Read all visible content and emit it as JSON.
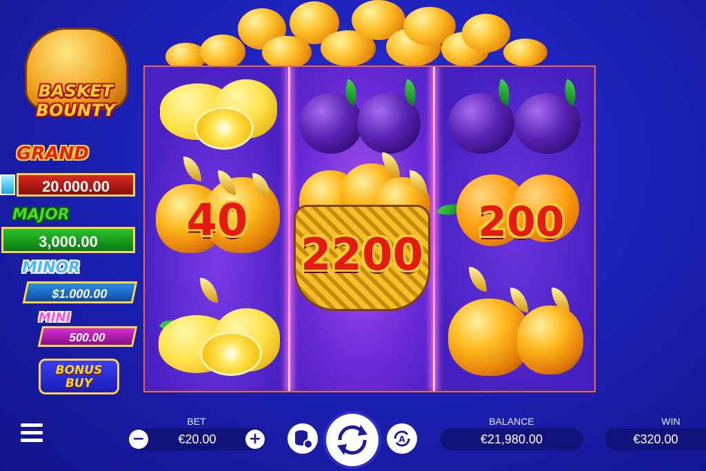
{
  "game": {
    "logo_line1": "BASKET",
    "logo_line2": "BOUNTY"
  },
  "jackpots": {
    "grand": {
      "label": "GRAND",
      "value": "20.000.00"
    },
    "major": {
      "label": "MAJOR",
      "value": "3,000.00"
    },
    "minor": {
      "label": "MINOR",
      "value": "$1.000.00"
    },
    "mini": {
      "label": "MINI",
      "value": "500.00"
    }
  },
  "bonus_buy": {
    "line1": "BONUS",
    "line2": "BUY"
  },
  "reels": [
    [
      {
        "symbol": "lemon-icon"
      },
      {
        "symbol": "golden-apple-icon",
        "value": "40"
      },
      {
        "symbol": "lemon-icon"
      }
    ],
    [
      {
        "symbol": "plum-icon"
      },
      {
        "symbol": "golden-basket-icon",
        "value": "2200"
      }
    ],
    [
      {
        "symbol": "plum-icon"
      },
      {
        "symbol": "orange-icon",
        "value": "200"
      },
      {
        "symbol": "golden-apple-icon"
      }
    ]
  ],
  "bottom_bar": {
    "bet_label": "BET",
    "bet_value": "€20.00",
    "balance_label": "BALANCE",
    "balance_value": "€21,980.00",
    "win_label": "WIN",
    "win_value": "€320.00",
    "icons": [
      "menu-icon",
      "minus-icon",
      "plus-icon",
      "coins-settings-icon",
      "spin-icon",
      "autoplay-icon"
    ]
  },
  "colors": {
    "background": "#1d22b8",
    "reel_frame": "#f06a3a",
    "value_text": "#e51b12",
    "value_outline": "#ffcf3b"
  }
}
